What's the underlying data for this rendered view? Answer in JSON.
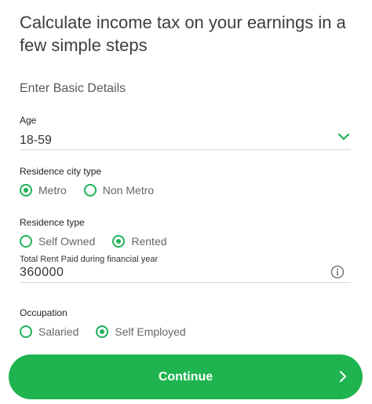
{
  "heading": "Calculate income tax on your earnings in a few simple steps",
  "section_label": "Enter Basic Details",
  "age": {
    "label": "Age",
    "value": "18-59"
  },
  "residence_city": {
    "label": "Residence city type",
    "options": [
      {
        "label": "Metro",
        "selected": true
      },
      {
        "label": "Non Metro",
        "selected": false
      }
    ]
  },
  "residence_type": {
    "label": "Residence type",
    "options": [
      {
        "label": "Self Owned",
        "selected": false
      },
      {
        "label": "Rented",
        "selected": true
      }
    ]
  },
  "rent": {
    "label": "Total Rent Paid during financial year",
    "value": "360000"
  },
  "occupation": {
    "label": "Occupation",
    "options": [
      {
        "label": "Salaried",
        "selected": false
      },
      {
        "label": "Self Employed",
        "selected": true
      }
    ]
  },
  "continue_label": "Continue",
  "colors": {
    "accent": "#1fb25a",
    "button": "#1fb44f"
  }
}
